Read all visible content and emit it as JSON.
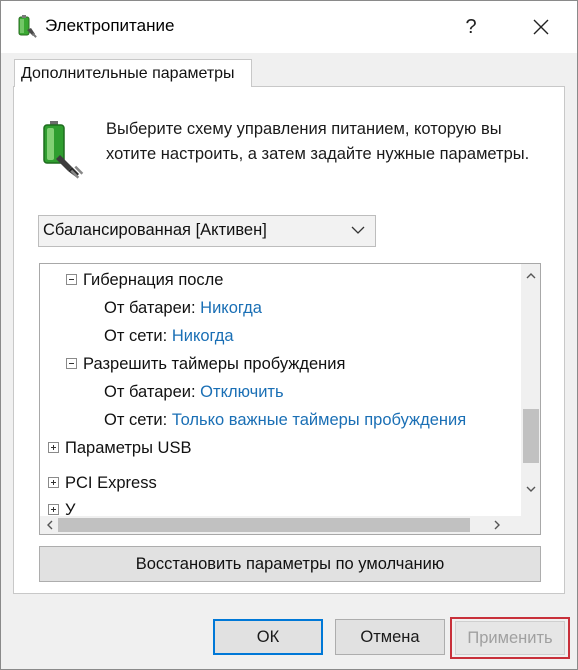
{
  "window": {
    "title": "Электропитание",
    "help_label": "?",
    "tab_label": "Дополнительные параметры"
  },
  "intro": {
    "text": "Выберите схему управления питанием, которую вы хотите настроить, а затем задайте нужные параметры."
  },
  "plan_combo": {
    "selected": "Сбалансированная [Активен]"
  },
  "tree": {
    "hibernate": {
      "label": "Гибернация после",
      "battery_label": "От батареи:",
      "battery_value": "Никогда",
      "ac_label": "От сети:",
      "ac_value": "Никогда"
    },
    "wake_timers": {
      "label": "Разрешить таймеры пробуждения",
      "battery_label": "От батареи:",
      "battery_value": "Отключить",
      "ac_label": "От сети:",
      "ac_value": "Только важные таймеры пробуждения"
    },
    "usb": {
      "label": "Параметры USB"
    },
    "pci": {
      "label": "PCI Express"
    },
    "partial": {
      "label": "У"
    }
  },
  "buttons": {
    "restore": "Восстановить параметры по умолчанию",
    "ok": "ОК",
    "cancel": "Отмена",
    "apply": "Применить"
  },
  "colors": {
    "link": "#1a6fb5",
    "focus_border": "#0078d7",
    "highlight_outline": "#c8303a",
    "disabled_text": "#a0a0a0"
  },
  "icons": {
    "title": "power-options-icon",
    "header": "battery-plug-icon"
  }
}
